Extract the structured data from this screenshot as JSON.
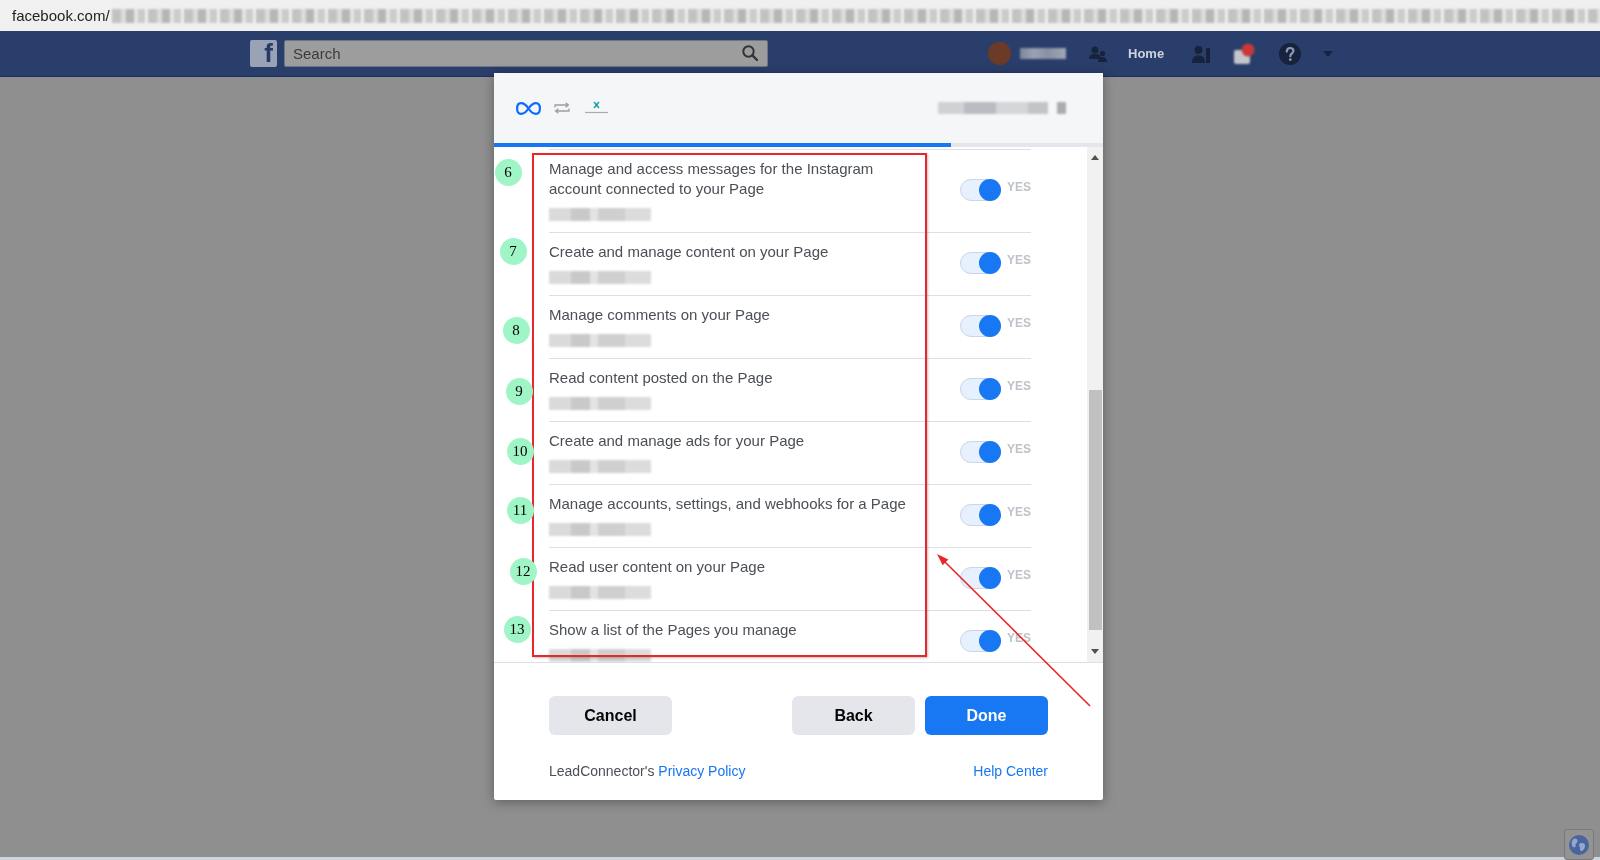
{
  "address_bar": {
    "url": "facebook.com/"
  },
  "top_bar": {
    "logo": "f",
    "search": {
      "placeholder": "Search"
    },
    "home_link": "Home"
  },
  "dialog": {
    "progress": {
      "level": 0.75
    },
    "permissions": [
      {
        "title": "Manage and access messages for the Instagram account connected to your Page",
        "on": true,
        "toggle_label": "YES"
      },
      {
        "title": "Create and manage content on your Page",
        "on": true,
        "toggle_label": "YES"
      },
      {
        "title": "Manage comments on your Page",
        "on": true,
        "toggle_label": "YES"
      },
      {
        "title": "Read content posted on the Page",
        "on": true,
        "toggle_label": "YES"
      },
      {
        "title": "Create and manage ads for your Page",
        "on": true,
        "toggle_label": "YES"
      },
      {
        "title": "Manage accounts, settings, and webhooks for a Page",
        "on": true,
        "toggle_label": "YES"
      },
      {
        "title": "Read user content on your Page",
        "on": true,
        "toggle_label": "YES"
      },
      {
        "title": "Show a list of the Pages you manage",
        "on": true,
        "toggle_label": "YES"
      }
    ],
    "buttons": [
      {
        "label": "Cancel",
        "kind": "secondary"
      },
      {
        "label": "Back",
        "kind": "secondary"
      },
      {
        "label": "Done",
        "kind": "primary"
      }
    ],
    "footer": {
      "note": "LeadConnector's",
      "privacy_link": "Privacy Policy",
      "help_link": "Help Center"
    }
  },
  "annotations": {
    "markers": [
      {
        "label": "6"
      },
      {
        "label": "7"
      },
      {
        "label": "8"
      },
      {
        "label": "9"
      },
      {
        "label": "10"
      },
      {
        "label": "11"
      },
      {
        "label": "12"
      },
      {
        "label": "13"
      }
    ]
  }
}
